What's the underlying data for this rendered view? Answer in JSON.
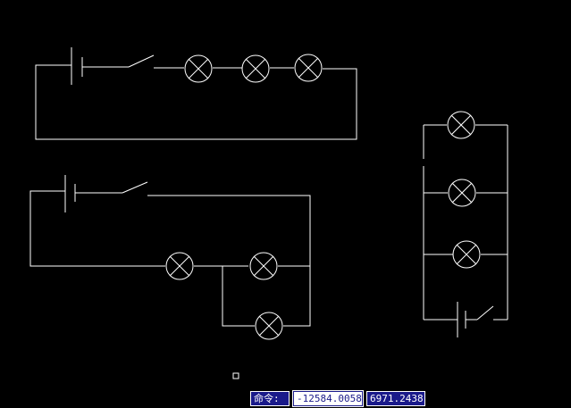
{
  "app": {
    "background_color": "#000000",
    "wire_color": "#ffffff"
  },
  "command_bar": {
    "label": "命令:",
    "coord_x": "-12584.0058",
    "coord_y": "6971.2438",
    "label_bg": "#1a1a8a",
    "active_bg": "#ffffff"
  },
  "drawing": {
    "circuits": [
      {
        "id": "series-circuit",
        "components": [
          "battery",
          "switch",
          "lamp",
          "lamp",
          "lamp"
        ]
      },
      {
        "id": "mixed-circuit",
        "components": [
          "battery",
          "switch",
          "lamp",
          "lamp",
          "lamp"
        ]
      },
      {
        "id": "parallel-circuit",
        "components": [
          "lamp",
          "lamp",
          "lamp",
          "battery",
          "switch"
        ]
      }
    ],
    "icons": [
      "lamp-icon",
      "battery-icon",
      "switch-icon",
      "pickbox-cursor-icon"
    ]
  }
}
